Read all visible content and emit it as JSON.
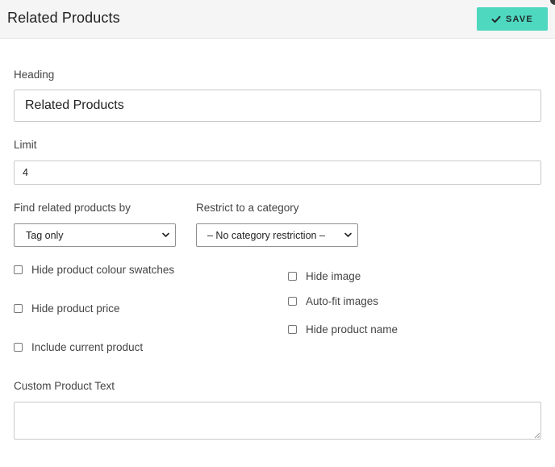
{
  "header": {
    "title": "Related Products",
    "save_label": "SAVE"
  },
  "form": {
    "heading": {
      "label": "Heading",
      "value": "Related Products"
    },
    "limit": {
      "label": "Limit",
      "value": "4"
    },
    "find_by": {
      "label": "Find related products by",
      "selected": "Tag only"
    },
    "category": {
      "label": "Restrict to a category",
      "selected": "– No category restriction –"
    },
    "checkboxes_left": [
      {
        "label": "Hide product colour swatches",
        "checked": false
      },
      {
        "label": "Hide product price",
        "checked": false
      },
      {
        "label": "Include current product",
        "checked": false
      }
    ],
    "checkboxes_right": [
      {
        "label": "Hide image",
        "checked": false
      },
      {
        "label": "Auto-fit images",
        "checked": false
      },
      {
        "label": "Hide product name",
        "checked": false
      }
    ],
    "custom_text": {
      "label": "Custom Product Text",
      "value": ""
    }
  },
  "colors": {
    "accent": "#4fd8c0",
    "header_bg": "#f5f5f5"
  },
  "icons": {
    "save": "check-icon",
    "select": "chevron-down-icon"
  }
}
